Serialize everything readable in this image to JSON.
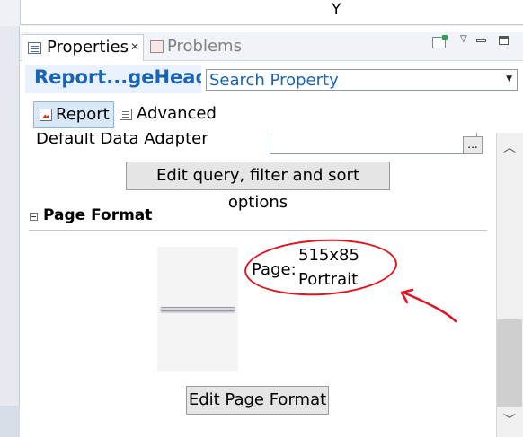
{
  "top": {
    "column_label": "Y"
  },
  "tabs": {
    "properties_label": "Properties",
    "properties_close": "✕",
    "problems_label": "Problems"
  },
  "header": {
    "title": "Report...geHead",
    "search_placeholder": "Search Property"
  },
  "toolbar": {
    "report_label": "Report",
    "advanced_label": "Advanced"
  },
  "properties": {
    "data_adapter_label": "Default Data Adapter",
    "browse_label": "...",
    "edit_query_label": "Edit query, filter and sort options"
  },
  "page_format": {
    "section_title": "Page Format",
    "page_label": "Page:",
    "size": "515x85",
    "orientation": "Portrait",
    "edit_button_label": "Edit Page Format"
  },
  "colors": {
    "accent": "#1a64b4",
    "annotation": "#e0141e"
  }
}
